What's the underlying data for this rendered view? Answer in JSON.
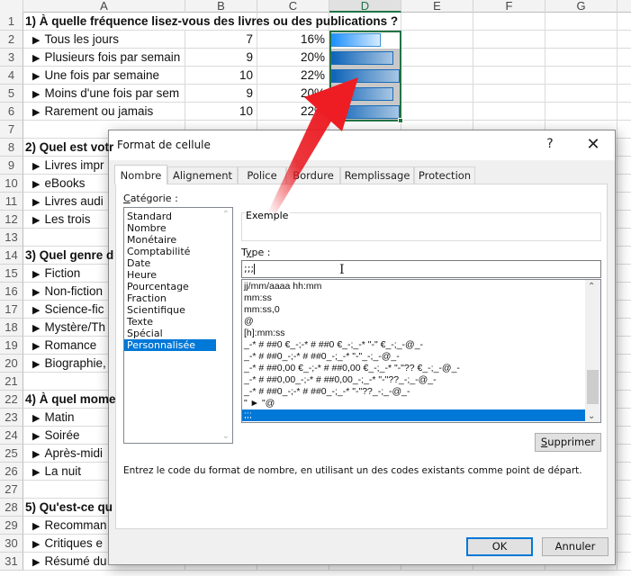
{
  "spreadsheet": {
    "columns": [
      "A",
      "B",
      "C",
      "D",
      "E",
      "F",
      "G"
    ],
    "selected_column": "D",
    "rows": [
      {
        "num": "1",
        "type": "question",
        "text": "1) À quelle fréquence lisez-vous des livres ou des publications ?"
      },
      {
        "num": "2",
        "type": "answer",
        "text": "Tous les jours",
        "count": "7",
        "percent": "16%",
        "bar_value": 0.16
      },
      {
        "num": "3",
        "type": "answer",
        "text": "Plusieurs fois par semain",
        "count": "9",
        "percent": "20%",
        "bar_value": 0.2
      },
      {
        "num": "4",
        "type": "answer",
        "text": "Une fois par semaine",
        "count": "10",
        "percent": "22%",
        "bar_value": 0.22
      },
      {
        "num": "5",
        "type": "answer",
        "text": "Moins d'une fois par sem",
        "count": "9",
        "percent": "20%",
        "bar_value": 0.2
      },
      {
        "num": "6",
        "type": "answer",
        "text": "Rarement ou jamais",
        "count": "10",
        "percent": "22%",
        "bar_value": 0.22
      },
      {
        "num": "7",
        "type": "empty"
      },
      {
        "num": "8",
        "type": "question",
        "text": "2) Quel est votr"
      },
      {
        "num": "9",
        "type": "answer",
        "text": "Livres impr"
      },
      {
        "num": "10",
        "type": "answer",
        "text": "eBooks"
      },
      {
        "num": "11",
        "type": "answer",
        "text": "Livres audi"
      },
      {
        "num": "12",
        "type": "answer",
        "text": "Les trois"
      },
      {
        "num": "13",
        "type": "empty"
      },
      {
        "num": "14",
        "type": "question",
        "text": "3) Quel genre d"
      },
      {
        "num": "15",
        "type": "answer",
        "text": "Fiction"
      },
      {
        "num": "16",
        "type": "answer",
        "text": "Non-fiction"
      },
      {
        "num": "17",
        "type": "answer",
        "text": "Science-fic"
      },
      {
        "num": "18",
        "type": "answer",
        "text": "Mystère/Th"
      },
      {
        "num": "19",
        "type": "answer",
        "text": "Romance"
      },
      {
        "num": "20",
        "type": "answer",
        "text": "Biographie,"
      },
      {
        "num": "21",
        "type": "empty"
      },
      {
        "num": "22",
        "type": "question",
        "text": "4) À quel mome"
      },
      {
        "num": "23",
        "type": "answer",
        "text": "Matin"
      },
      {
        "num": "24",
        "type": "answer",
        "text": "Soirée"
      },
      {
        "num": "25",
        "type": "answer",
        "text": "Après-midi"
      },
      {
        "num": "26",
        "type": "answer",
        "text": "La nuit"
      },
      {
        "num": "27",
        "type": "empty"
      },
      {
        "num": "28",
        "type": "question",
        "text": "5) Qu'est-ce qu"
      },
      {
        "num": "29",
        "type": "answer",
        "text": "Recomman"
      },
      {
        "num": "30",
        "type": "answer",
        "text": "Critiques e"
      },
      {
        "num": "31",
        "type": "answer",
        "text": "Résumé du livre"
      }
    ],
    "bullet_glyph": "▶",
    "colors": {
      "selection": "#217346",
      "bar_fill": "#0d63b8"
    }
  },
  "dialog": {
    "title": "Format de cellule",
    "help_label": "?",
    "close_label": "✕",
    "tabs": [
      {
        "label": "Nombre",
        "active": true
      },
      {
        "label": "Alignement",
        "active": false
      },
      {
        "label": "Police",
        "active": false
      },
      {
        "label": "Bordure",
        "active": false
      },
      {
        "label": "Remplissage",
        "active": false
      },
      {
        "label": "Protection",
        "active": false
      }
    ],
    "category_label_first": "C",
    "category_label_rest": "atégorie :",
    "categories": [
      "Standard",
      "Nombre",
      "Monétaire",
      "Comptabilité",
      "Date",
      "Heure",
      "Pourcentage",
      "Fraction",
      "Scientifique",
      "Texte",
      "Spécial",
      "Personnalisée"
    ],
    "selected_category": "Personnalisée",
    "example_label": "Exemple",
    "type_label_first": "T",
    "type_label_mid": "y",
    "type_label_rest": "pe :",
    "type_value": ";;;",
    "type_list": [
      "jj/mm/aaaa hh:mm",
      "mm:ss",
      "mm:ss,0",
      "@",
      "[h]:mm:ss",
      "_-* # ##0 €_-;-* # ##0 €_-;_-* \"-\" €_-;_-@_-",
      "_-* # ##0_-;-* # ##0_-;_-* \"-\"_-;_-@_-",
      "_-* # ##0,00 €_-;-* # ##0,00 €_-;_-* \"-\"?? €_-;_-@_-",
      "_-* # ##0,00_-;-* # ##0,00_-;_-* \"-\"??_-;_-@_-",
      "_-* # ##0_-;-* # ##0_-;_-* \"-\"??_-;_-@_-",
      "\" ► \"@",
      ";;;"
    ],
    "selected_type": ";;;",
    "delete_button_first": "S",
    "delete_button_rest": "upprimer",
    "hint": "Entrez le code du format de nombre, en utilisant un des codes existants comme point de départ.",
    "ok_label": "OK",
    "cancel_label": "Annuler",
    "accent_color": "#0078d7"
  },
  "annotation": {
    "arrow_color": "#e8141c",
    "description": "red-arrow-pointing-to-data-bars"
  }
}
